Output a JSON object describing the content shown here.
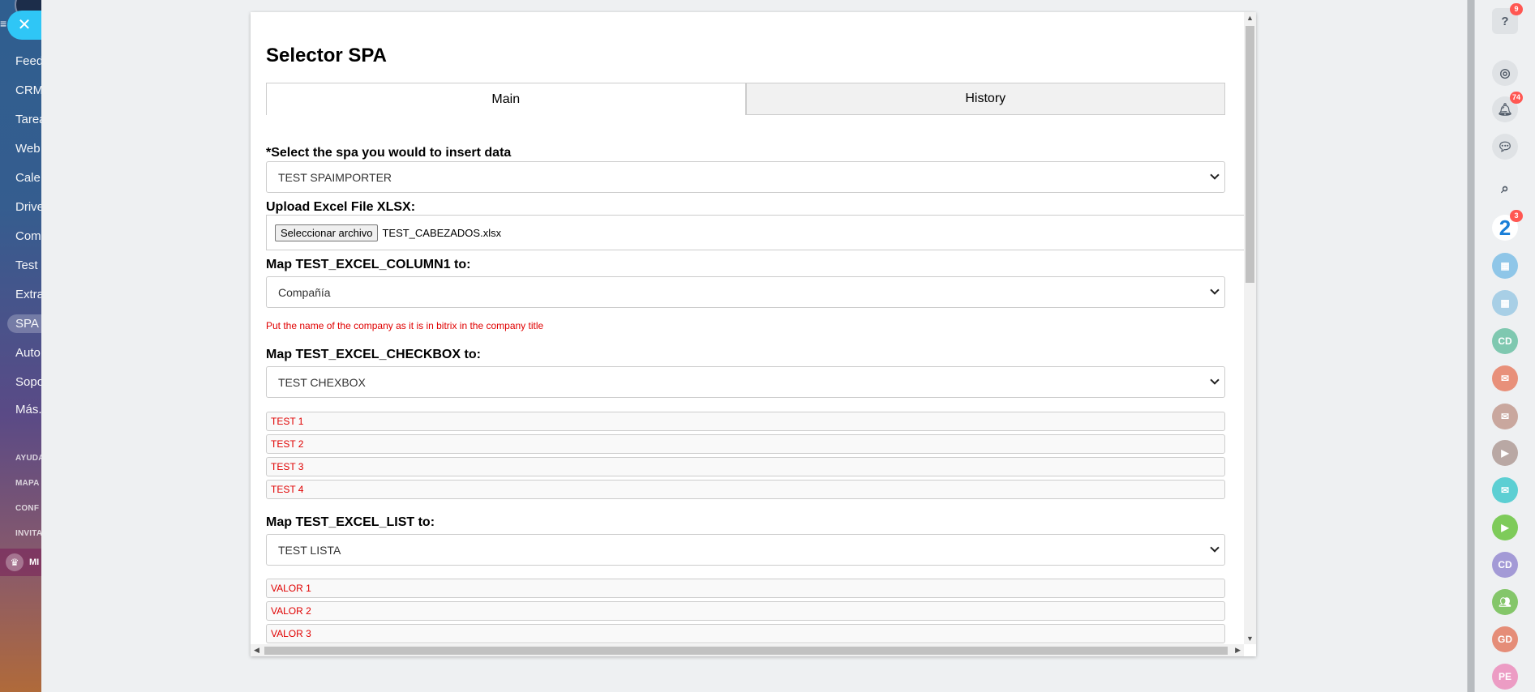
{
  "left_nav": {
    "items": [
      "Feed",
      "CRM",
      "Tarea",
      "Web",
      "Cale",
      "Drive",
      "Com",
      "Test",
      "Extra",
      "SPA",
      "Auto",
      "Sopo",
      "Más..."
    ],
    "small_items": [
      "AYUDA",
      "MAPA",
      "CONF",
      "INVITA"
    ],
    "crown_label": "MI",
    "close_symbol": "✕"
  },
  "panel": {
    "title": "Selector SPA",
    "tabs": [
      "Main",
      "History"
    ],
    "spa_field": {
      "required_mark": "*",
      "label": "Select the spa you would to insert data",
      "value": "TEST SPAIMPORTER"
    },
    "upload": {
      "label": "Upload Excel File XLSX:",
      "button": "Seleccionar archivo",
      "file_name": "TEST_CABEZADOS.xlsx"
    },
    "map_column1": {
      "label": "Map TEST_EXCEL_COLUMN1 to:",
      "value": "Compañía",
      "hint": "Put the name of the company as it is in bitrix in the company title"
    },
    "map_checkbox": {
      "label": "Map TEST_EXCEL_CHECKBOX to:",
      "value": "TEST CHEXBOX",
      "options": [
        "TEST 1",
        "TEST 2",
        "TEST 3",
        "TEST 4"
      ]
    },
    "map_list": {
      "label": "Map TEST_EXCEL_LIST to:",
      "value": "TEST LISTA",
      "options": [
        "VALOR 1",
        "VALOR 2",
        "VALOR 3"
      ]
    }
  },
  "right_bar": {
    "help_badge": "9",
    "notifications_badge": "74",
    "b24_badge": "3",
    "avatars": [
      "CD",
      "CD",
      "GD",
      "PE"
    ]
  },
  "colors": {
    "accent": "#2fc6f6",
    "hint_red": "#e00000",
    "badge_red": "#ff5752"
  }
}
